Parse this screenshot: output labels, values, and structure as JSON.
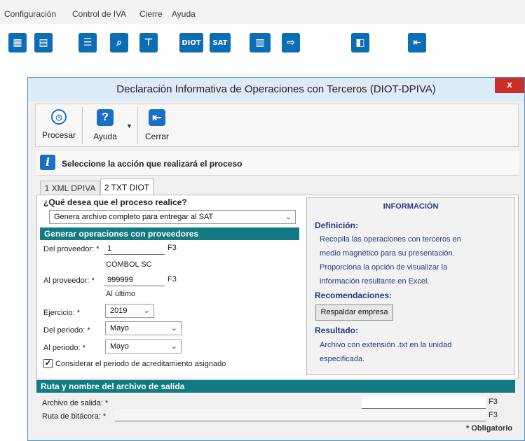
{
  "menu": {
    "items": [
      "Configuración",
      "Control de IVA",
      "Cierre",
      "Ayuda"
    ]
  },
  "app_toolbar": {
    "icons": [
      "calculator-icon",
      "spreadsheet-icon",
      "report-icon",
      "search-report-icon",
      "tax-icon",
      "diot-icon",
      "sat-icon",
      "chart-icon",
      "export-icon",
      "user-manual-icon",
      "exit-icon"
    ],
    "diot_label": "DIOT",
    "sat_label": "SAT"
  },
  "dialog": {
    "title": "Declaración Informativa de Operaciones con Terceros (DIOT-DPIVA)",
    "close_label": "x",
    "toolbar": {
      "procesar": "Procesar",
      "ayuda": "Ayuda",
      "cerrar": "Cerrar"
    },
    "banner": "Seleccione la acción que realizará el proceso",
    "tabs": [
      "1 XML DPIVA",
      "2 TXT DIOT"
    ],
    "active_tab": 1,
    "question": "¿Qué desea que el proceso realice?",
    "process_select": "Genera archivo completo para entregar al SAT",
    "section_proveedores": "Generar operaciones con proveedores",
    "del_proveedor": {
      "label": "Del proveedor: *",
      "value": "1",
      "key": "F3",
      "name": "COMBOL SC"
    },
    "al_proveedor": {
      "label": "Al proveedor: *",
      "value": "999999",
      "key": "F3",
      "name": "Al último"
    },
    "ejercicio": {
      "label": "Ejercicio: *",
      "value": "2019"
    },
    "del_periodo": {
      "label": "Del periodo: *",
      "value": "Mayo"
    },
    "al_periodo": {
      "label": "Al periodo: *",
      "value": "Mayo"
    },
    "checkbox": {
      "label": "Considerar el periodo de acreditamiento asignado",
      "checked": true,
      "mark": "✓"
    },
    "info": {
      "heading": "INFORMACIÓN",
      "definicion_title": "Definición:",
      "definicion_lines": [
        "Recopila las operaciones con terceros  en",
        "medio magnético para su presentación.",
        "Proporciona la opción de visualizar la",
        "información resultante en Excel."
      ],
      "recomendaciones_title": "Recomendaciones:",
      "respaldar_button": "Respaldar empresa",
      "resultado_title": "Resultado:",
      "resultado_lines": [
        "Archivo con extensión .txt en la unidad",
        "especificada."
      ]
    },
    "section_ruta": "Ruta y nombre del archivo de salida",
    "archivo_salida": {
      "label": "Archivo de salida: *",
      "key": "F3"
    },
    "ruta_bitacora": {
      "label": "Ruta de bitácora: *",
      "key": "F3"
    },
    "required_note": "* Obligatorio"
  },
  "colors": {
    "section_teal": "#127a82",
    "info_blue": "#223a82",
    "icon_blue": "#0c6db4",
    "close_red": "#c9302c"
  }
}
